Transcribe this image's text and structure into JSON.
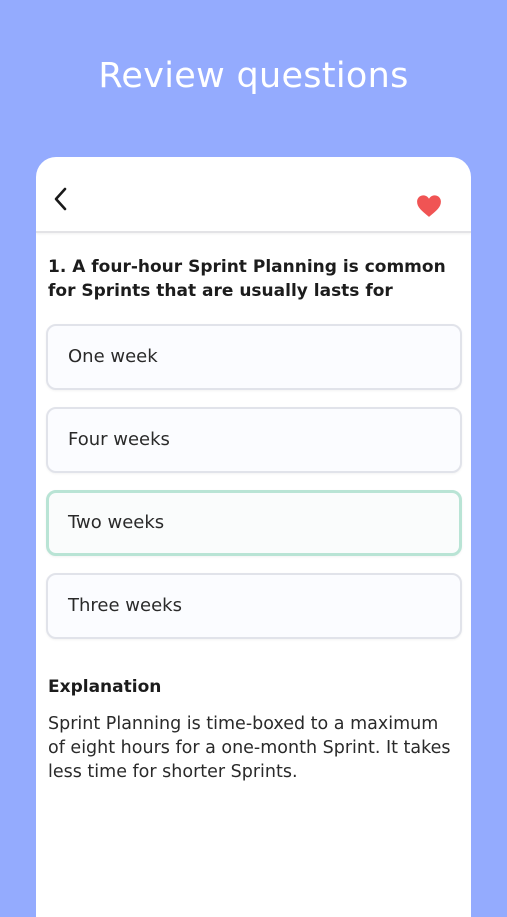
{
  "page": {
    "title": "Review questions"
  },
  "toolbar": {
    "back_icon": "chevron-left-icon",
    "favorite_icon": "heart-icon",
    "favorite_color": "#f05454"
  },
  "question": {
    "text": "1. A four-hour Sprint Planning is common for Sprints that are usually lasts for"
  },
  "options": [
    {
      "label": "One week",
      "state": "default"
    },
    {
      "label": "Four weeks",
      "state": "default"
    },
    {
      "label": "Two weeks",
      "state": "correct"
    },
    {
      "label": "Three weeks",
      "state": "default"
    }
  ],
  "explanation": {
    "heading": "Explanation",
    "body": "Sprint Planning is time-boxed to a maximum of eight hours for a one-month Sprint. It takes less time for shorter Sprints."
  },
  "colors": {
    "background": "#94abfe",
    "correct_border": "#b9e4d5",
    "option_border": "#e1e3ea"
  }
}
